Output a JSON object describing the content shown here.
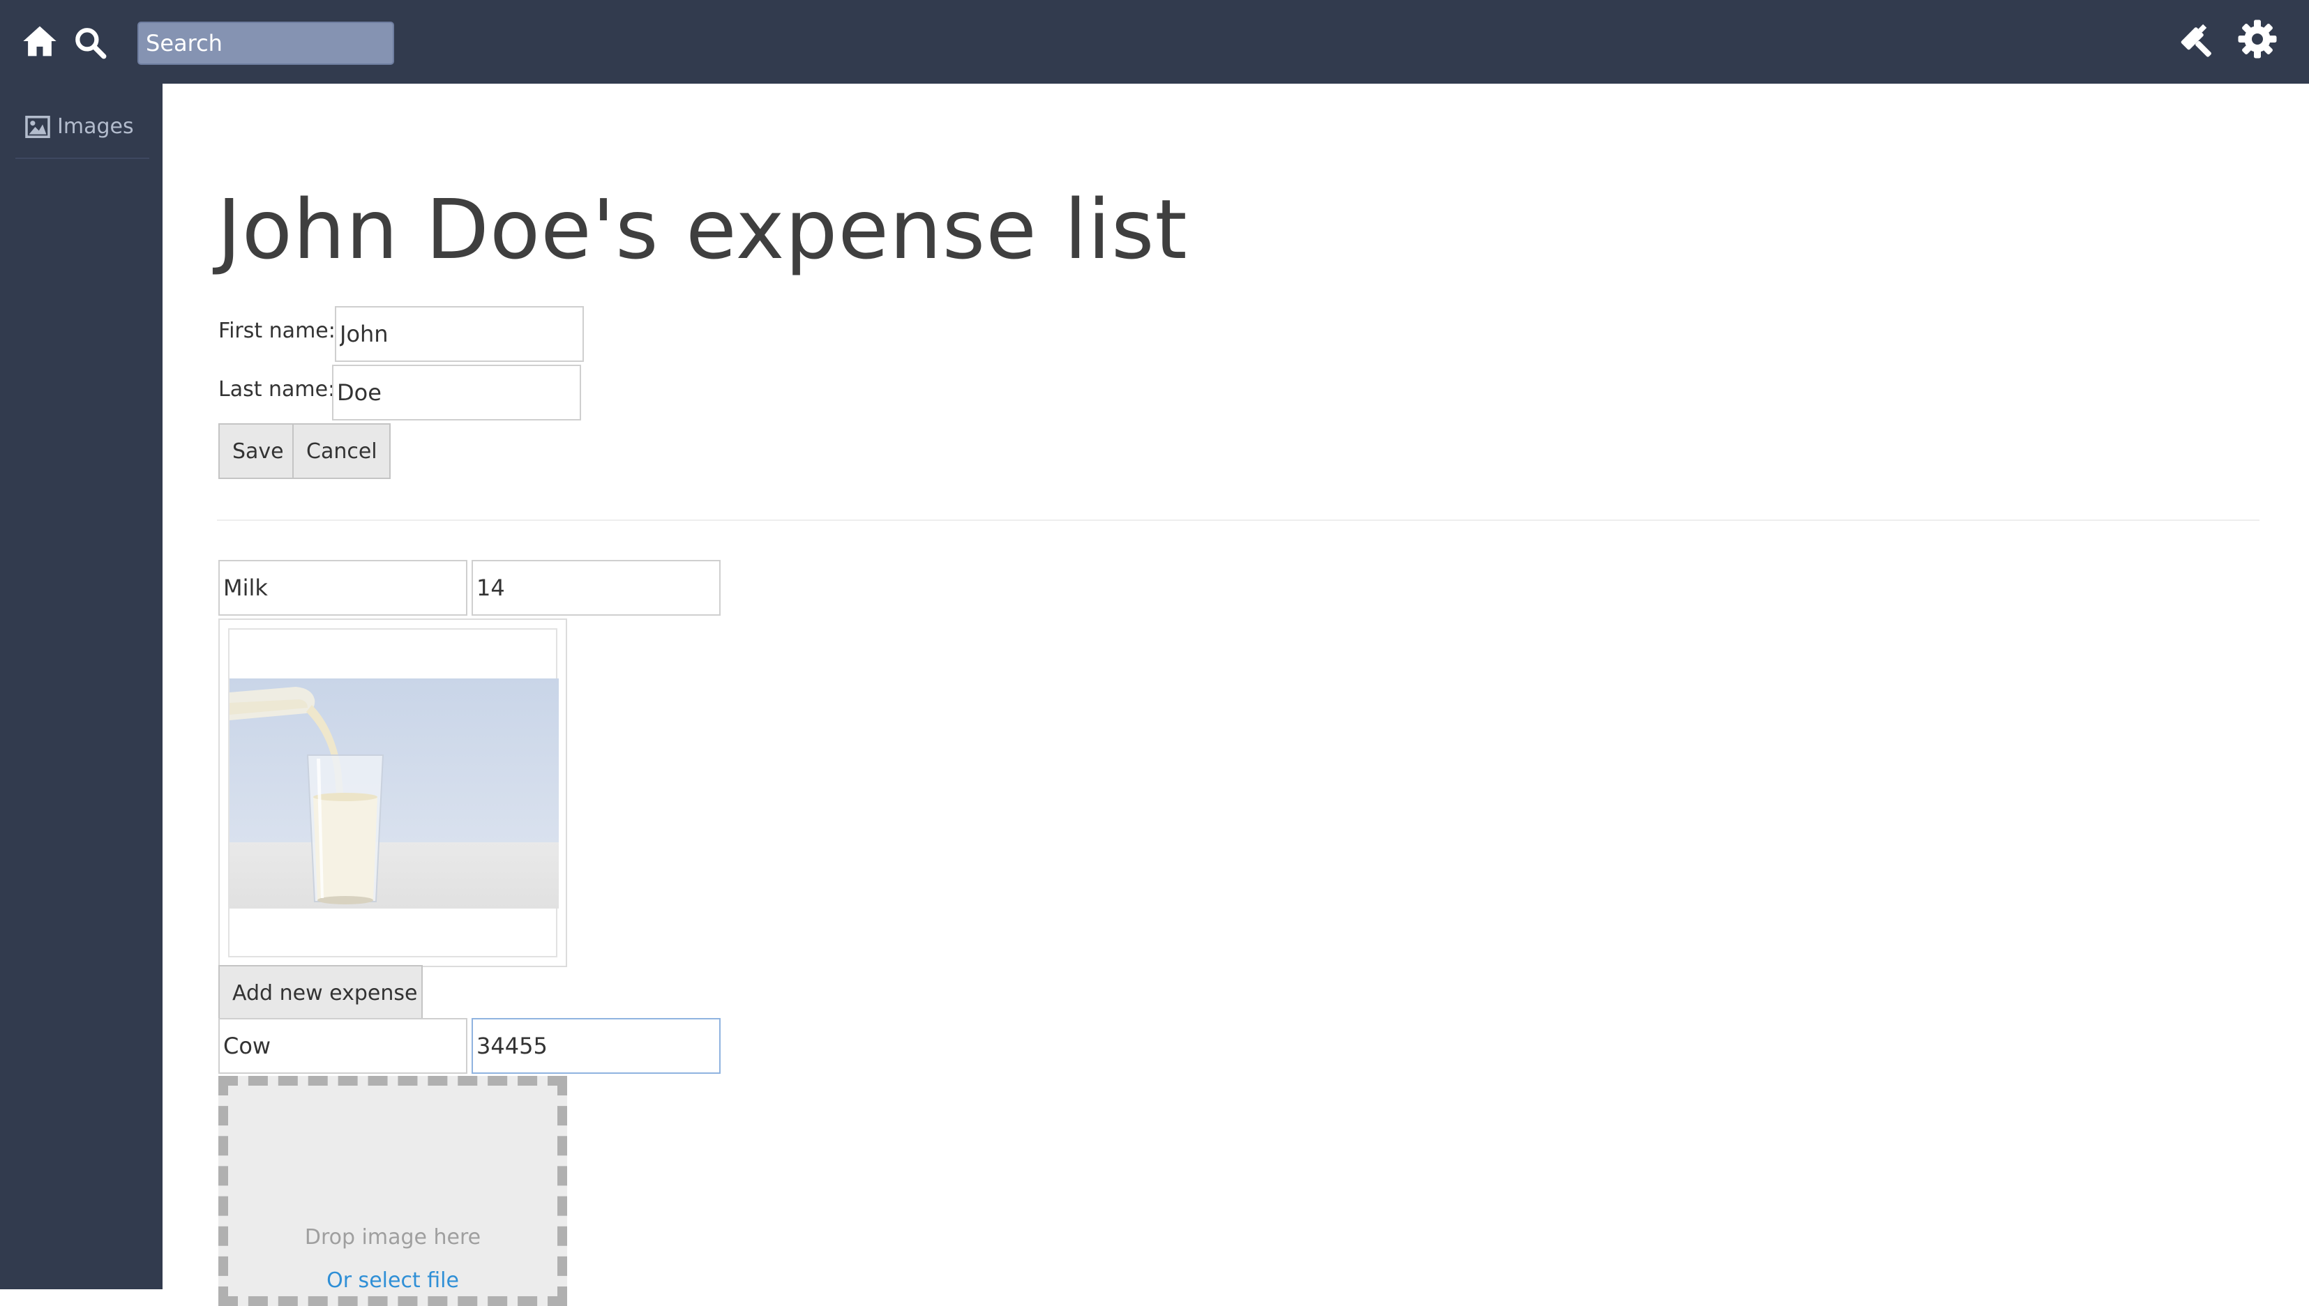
{
  "topbar": {
    "search": {
      "placeholder": "Search"
    },
    "icons": [
      "home-icon",
      "search-icon",
      "hammer-icon",
      "gear-icon"
    ]
  },
  "sidebar": {
    "items": [
      {
        "label": "Images",
        "icon": "image-icon"
      }
    ]
  },
  "main": {
    "title": "John Doe's expense list",
    "form": {
      "first_name_label": "First name:",
      "first_name_value": "John",
      "last_name_label": "Last name:",
      "last_name_value": "Doe",
      "save_label": "Save",
      "cancel_label": "Cancel"
    },
    "expenses": [
      {
        "name": "Milk",
        "amount": "14",
        "image": "milk-pouring-into-glass"
      }
    ],
    "add_expense_label": "Add new expense",
    "new_expense": {
      "name": "Cow",
      "amount": "34455"
    },
    "dropzone": {
      "drop_text": "Drop image here",
      "select_text": "Or select file"
    }
  },
  "colors": {
    "topbar_bg": "#323b4e",
    "search_bg": "#8593b2",
    "link": "#2f8fd6",
    "focus_border": "#8fb3e0"
  }
}
